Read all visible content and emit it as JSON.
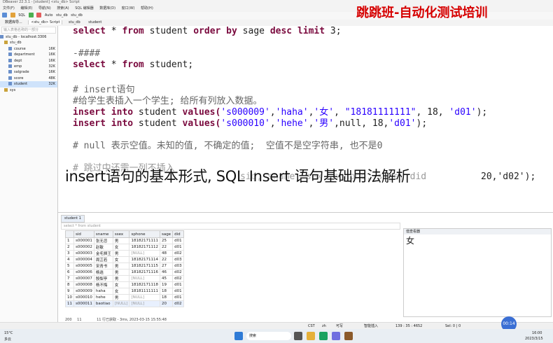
{
  "window": {
    "title": "DBeaver 22.3.1 - [student] <stu_db> Script"
  },
  "menu": [
    "文件(F)",
    "编辑(E)",
    "导航(N)",
    "搜索(A)",
    "SQL 编辑器",
    "数据库(D)",
    "窗口(W)",
    "帮助(H)"
  ],
  "toolbar": {
    "sql_label": "SQL",
    "commit_mode": "Auto",
    "connection": "stu_db",
    "schema": "stu_db"
  },
  "editor_tabs": [
    "<stu_db> Script",
    "stu_db",
    "student"
  ],
  "sidebar": {
    "tab_label": "数据库导...",
    "filter_placeholder": "输入表格名称的一部分",
    "connection": "stu_db - localhost:3306",
    "schema": "stu_db",
    "tables": [
      {
        "name": "course",
        "size": "16K"
      },
      {
        "name": "department",
        "size": "16K"
      },
      {
        "name": "dept",
        "size": "16K"
      },
      {
        "name": "emp",
        "size": "32K"
      },
      {
        "name": "salgrade",
        "size": "16K"
      },
      {
        "name": "score",
        "size": "48K"
      },
      {
        "name": "student",
        "size": "32K"
      }
    ],
    "other_schema": "sys"
  },
  "editor": {
    "lines": {
      "l1a": "select",
      "l1b": " * ",
      "l1c": "from",
      "l1d": " student ",
      "l1e": "order by",
      "l1f": " sage ",
      "l1g": "desc limit",
      "l1h": " 3;",
      "l2": "-####",
      "l3a": "select",
      "l3b": " * ",
      "l3c": "from",
      "l3d": " student;",
      "l4": "# insert语句",
      "l5": "#给学生表插入一个学生; 给所有列放入数据。",
      "l6a": "insert into",
      "l6b": " student ",
      "l6c": "values(",
      "l6d": "'s000009'",
      "l6e": ",",
      "l6f": "'haha'",
      "l6g": ",",
      "l6h": "'女'",
      "l6i": ", ",
      "l6j": "\"18181111111\"",
      "l6k": ", 18, ",
      "l6l": "'d01'",
      "l6m": ");",
      "l7a": "insert into",
      "l7b": " student ",
      "l7c": "values(",
      "l7d": "'s000010'",
      "l7e": ",",
      "l7f": "'hehe'",
      "l7g": ",",
      "l7h": "'男'",
      "l7i": ",null, 18,",
      "l7j": "'d01'",
      "l7k": ");",
      "l8": "# null 表示空值。未知的值, 不确定的值;  空值不是空字符串, 也不是0",
      "l9": "# 跳过中还需一列不插入",
      "l10": "sid, sname, sex, sphone, sage, did",
      "l10b": "20,'d02');"
    }
  },
  "overlay": {
    "caption": "insert语句的基本形式, SQL Insert 语句基础用法解析",
    "watermark": "跳跳班-自动化测试培训"
  },
  "results": {
    "tab_label": "student 1",
    "filter_placeholder": "select * from student",
    "columns": [
      "sid",
      "sname",
      "ssex",
      "sphone",
      "sage",
      "did"
    ],
    "rows": [
      [
        "1",
        "s000001",
        "张无忌",
        "男",
        "18182171111",
        "25",
        "d01"
      ],
      [
        "2",
        "s000002",
        "赵敏",
        "女",
        "18182171112",
        "22",
        "d01"
      ],
      [
        "3",
        "s000003",
        "金毛狮王",
        "男",
        "[NULL]",
        "48",
        "d02"
      ],
      [
        "4",
        "s000004",
        "周芷若",
        "女",
        "18182171114",
        "22",
        "d03"
      ],
      [
        "5",
        "s000005",
        "宋青书",
        "男",
        "18182171115",
        "27",
        "d03"
      ],
      [
        "6",
        "s000006",
        "杨逍",
        "男",
        "18182171116",
        "46",
        "d02"
      ],
      [
        "7",
        "s000007",
        "殷梨亭",
        "男",
        "[NULL]",
        "45",
        "d02"
      ],
      [
        "8",
        "s000008",
        "杨不悔",
        "女",
        "18182171118",
        "19",
        "d01"
      ],
      [
        "9",
        "s000009",
        "haha",
        "女",
        "18181111111",
        "18",
        "d01"
      ],
      [
        "10",
        "s000010",
        "hehe",
        "男",
        "[NULL]",
        "18",
        "d01"
      ],
      [
        "11",
        "s000011",
        "baotiao",
        "[NULL]",
        "[NULL]",
        "20",
        "d02"
      ]
    ],
    "value_panel_header": "值查看器",
    "value_panel_value": "女",
    "status": "11 行已获取 - 3ms, 2023-03-15 15:55:48",
    "row_count": "200",
    "fetched": "11"
  },
  "statusbar": {
    "timezone": "CST",
    "locale": "zh",
    "mode": "可写",
    "insert": "智能插入",
    "position": "139 : 35 : 4652",
    "sel": "Sel: 0 | 0"
  },
  "taskbar": {
    "weather": "15°C",
    "weather_desc": "多云",
    "search": "搜索",
    "time": "16:00",
    "date": "2023/3/15",
    "timer": "00:14"
  }
}
